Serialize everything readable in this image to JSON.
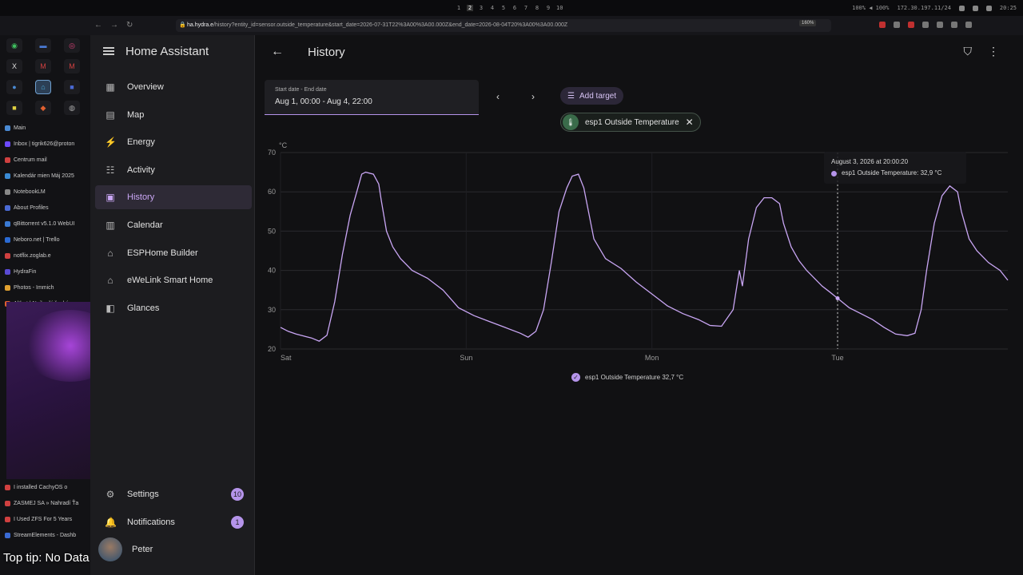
{
  "system_bar": {
    "workspaces": [
      "1",
      "2",
      "3",
      "4",
      "5",
      "6",
      "7",
      "8",
      "9",
      "10"
    ],
    "stats": "100% ◀ 100%",
    "ip": "172.30.197.11/24",
    "clock": "20:25"
  },
  "browser": {
    "url_domain": "ha.hydra.e",
    "url_path": "/history?entity_id=sensor.outside_temperature&start_date=2026-07-31T22%3A00%3A00.000Z&end_date=2026-08-04T20%3A00%3A00.000Z",
    "zoom": "160%",
    "tabs": [
      {
        "label": "Main",
        "color": "#4a8ad4"
      },
      {
        "label": "Inbox | tigrik626@proton",
        "color": "#6d4aff"
      },
      {
        "label": "Centrum mail",
        "color": "#d04040"
      },
      {
        "label": "Kalendár mien Máj 2025",
        "color": "#3a8ad4"
      },
      {
        "label": "NotebookLM",
        "color": "#888888"
      },
      {
        "label": "About Profiles",
        "color": "#4a6ad4"
      },
      {
        "label": "qBittorrent v5.1.0 WebUI",
        "color": "#3a7ad4"
      },
      {
        "label": "Neboro.net | Trello",
        "color": "#2a6ad4"
      },
      {
        "label": "notflix.zoglab.e",
        "color": "#d04040"
      },
      {
        "label": "HydraFin",
        "color": "#5a4ad4"
      },
      {
        "label": "Photos - Immich",
        "color": "#e0a030"
      },
      {
        "label": "Altbot | Nejlepší český",
        "color": "#e06030"
      }
    ],
    "lower_tabs": [
      {
        "label": "I installed CachyOS o",
        "color": "#d04040"
      },
      {
        "label": "ZASMEJ SA » Nahradí Ťa",
        "color": "#d04040"
      },
      {
        "label": "I Used ZFS For 5 Years",
        "color": "#d04040"
      },
      {
        "label": "StreamElements - Dashb",
        "color": "#3a6ad4"
      }
    ]
  },
  "overlay": {
    "top_tip": "Top tip: No Data"
  },
  "sidebar": {
    "app_title": "Home Assistant",
    "items": [
      {
        "label": "Overview",
        "icon": "grid-icon"
      },
      {
        "label": "Map",
        "icon": "map-icon"
      },
      {
        "label": "Energy",
        "icon": "lightning-icon"
      },
      {
        "label": "Activity",
        "icon": "list-icon"
      },
      {
        "label": "History",
        "icon": "chart-icon"
      },
      {
        "label": "Calendar",
        "icon": "calendar-icon"
      },
      {
        "label": "ESPHome Builder",
        "icon": "esphome-icon"
      },
      {
        "label": "eWeLink Smart Home",
        "icon": "home-icon"
      },
      {
        "label": "Glances",
        "icon": "glances-icon"
      }
    ],
    "settings": {
      "label": "Settings",
      "badge": "10"
    },
    "notifications": {
      "label": "Notifications",
      "badge": "1"
    },
    "user": {
      "name": "Peter"
    }
  },
  "header": {
    "title": "History"
  },
  "date_picker": {
    "label": "Start date - End date",
    "value": "Aug 1, 00:00 - Aug 4, 22:00"
  },
  "add_target_label": "Add target",
  "entity_chip": {
    "label": "esp1 Outside Temperature"
  },
  "tooltip": {
    "datetime": "August 3, 2026 at 20:00:20",
    "value": "esp1 Outside Temperature: 32,9 °C"
  },
  "legend": {
    "label": "esp1 Outside Temperature 32,7 °C"
  },
  "chart_data": {
    "type": "line",
    "ylabel": "°C",
    "ylim": [
      20,
      70
    ],
    "y_ticks": [
      "20",
      "30",
      "40",
      "50",
      "60",
      "70"
    ],
    "x_ticks": [
      "Sat",
      "Sun",
      "Mon",
      "Tue"
    ],
    "x_range_hours": [
      0,
      94
    ],
    "series": [
      {
        "name": "esp1 Outside Temperature",
        "color": "#c9a6f4",
        "points": [
          [
            0,
            25.5
          ],
          [
            1,
            24.5
          ],
          [
            2,
            23.8
          ],
          [
            3,
            23.3
          ],
          [
            4,
            22.8
          ],
          [
            5,
            22.0
          ],
          [
            6,
            23.5
          ],
          [
            7,
            32
          ],
          [
            8,
            44
          ],
          [
            9,
            54
          ],
          [
            10,
            61
          ],
          [
            10.5,
            64.5
          ],
          [
            11,
            65
          ],
          [
            12,
            64.5
          ],
          [
            12.7,
            62
          ],
          [
            13,
            58
          ],
          [
            13.7,
            50
          ],
          [
            14.5,
            46
          ],
          [
            15.5,
            43
          ],
          [
            17,
            40
          ],
          [
            19,
            38
          ],
          [
            21,
            35
          ],
          [
            23,
            30.5
          ],
          [
            25,
            28.5
          ],
          [
            27,
            27
          ],
          [
            29,
            25.5
          ],
          [
            31,
            24
          ],
          [
            32,
            23
          ],
          [
            33,
            24.5
          ],
          [
            34,
            30
          ],
          [
            35,
            42
          ],
          [
            36,
            55
          ],
          [
            37,
            61
          ],
          [
            37.7,
            64
          ],
          [
            38.5,
            64.5
          ],
          [
            39.2,
            61
          ],
          [
            39.8,
            55
          ],
          [
            40.5,
            48
          ],
          [
            42,
            43
          ],
          [
            44,
            40.5
          ],
          [
            46,
            37
          ],
          [
            48,
            34
          ],
          [
            50,
            31
          ],
          [
            52,
            29
          ],
          [
            54,
            27.5
          ],
          [
            55.5,
            26
          ],
          [
            57,
            25.8
          ],
          [
            58.5,
            30
          ],
          [
            59.3,
            40
          ],
          [
            59.7,
            36
          ],
          [
            60.5,
            48
          ],
          [
            61.5,
            56
          ],
          [
            62.5,
            58.5
          ],
          [
            63.5,
            58.5
          ],
          [
            64.5,
            57
          ],
          [
            65,
            52
          ],
          [
            66,
            46
          ],
          [
            67,
            42.5
          ],
          [
            68,
            40
          ],
          [
            69,
            38
          ],
          [
            70,
            36
          ],
          [
            71,
            34.5
          ],
          [
            72,
            32.9
          ],
          [
            73.5,
            30.5
          ],
          [
            75,
            29
          ],
          [
            76.5,
            27.5
          ],
          [
            78,
            25.5
          ],
          [
            79.5,
            23.8
          ],
          [
            81,
            23.4
          ],
          [
            82,
            24
          ],
          [
            82.8,
            30
          ],
          [
            83.5,
            40
          ],
          [
            84.5,
            52
          ],
          [
            85.5,
            59
          ],
          [
            86.5,
            61.5
          ],
          [
            87.5,
            60
          ],
          [
            88,
            55
          ],
          [
            89,
            48
          ],
          [
            90,
            45
          ],
          [
            91.5,
            42
          ],
          [
            93,
            40
          ],
          [
            94,
            37.5
          ]
        ]
      }
    ],
    "hover": {
      "x": 72,
      "y": 32.9
    }
  }
}
